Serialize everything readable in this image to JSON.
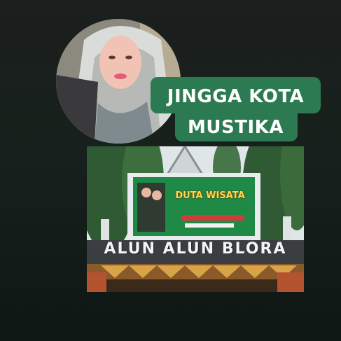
{
  "title": {
    "text": "JINGGA KOTA\nMUSTIKA",
    "color": "#ffffff",
    "background": "#2c7a52"
  },
  "profile_photo": {
    "icon": "profile-photo"
  },
  "park_photo": {
    "billboard_title": "DUTA WISATA",
    "sign": "ALUN ALUN BLORA"
  }
}
